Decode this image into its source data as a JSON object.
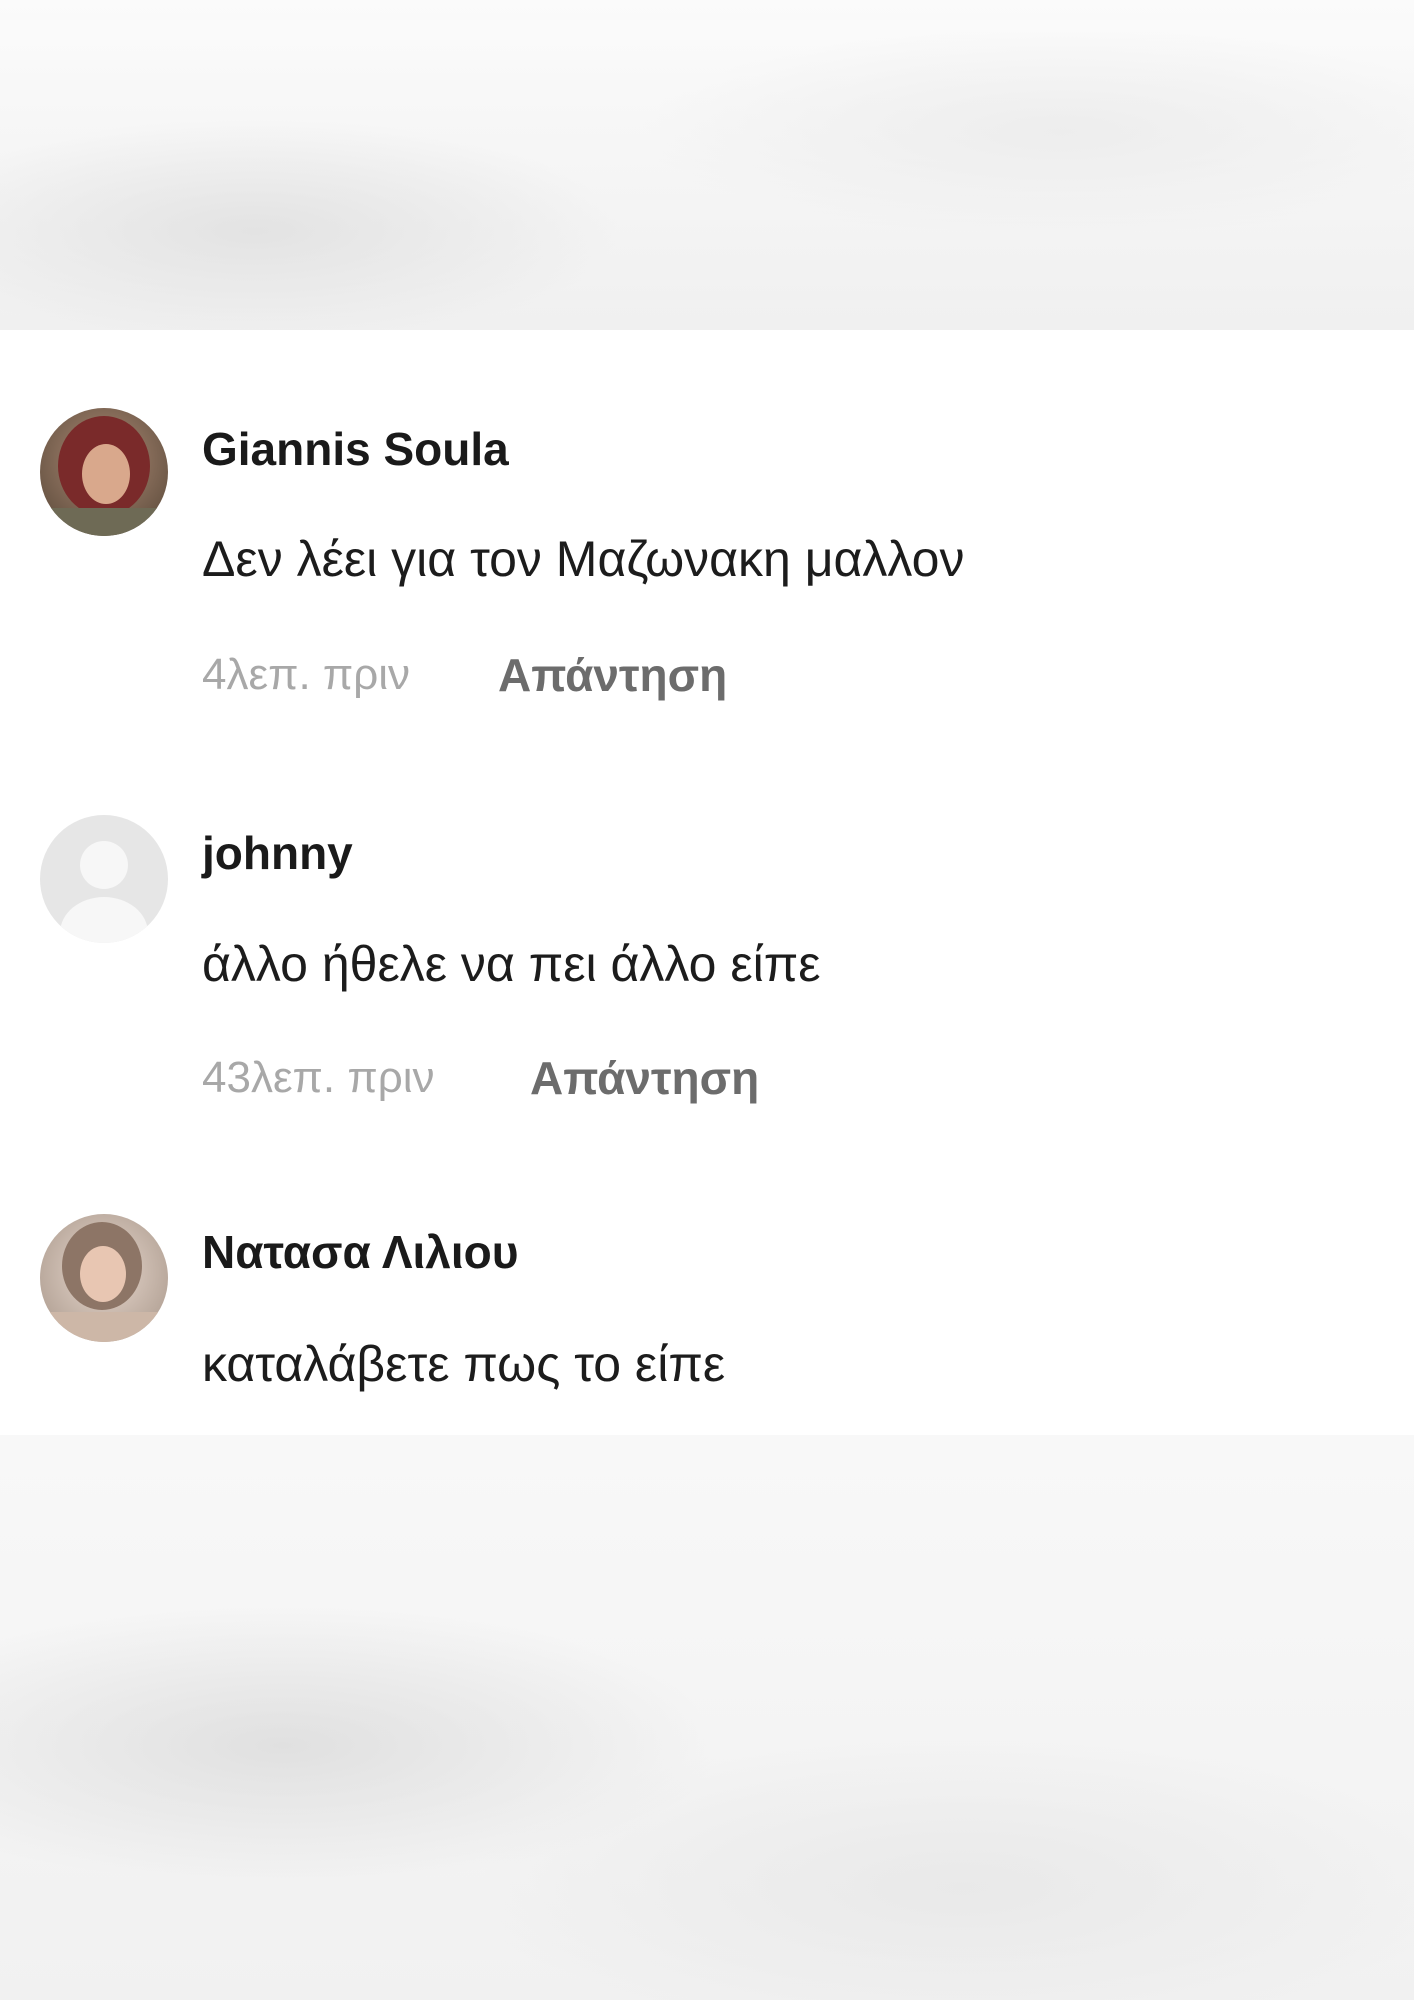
{
  "comments": [
    {
      "author": "Giannis Soula",
      "text": "Δεν λέει για τον Μαζωνακη μαλλον",
      "time": "4λεπ. πριν",
      "reply_label": "Απάντηση",
      "avatar": "user-photo-avatar"
    },
    {
      "author": "johnny",
      "text": "άλλο ήθελε να πει άλλο είπε",
      "time": "43λεπ. πριν",
      "reply_label": "Απάντηση",
      "avatar": "default-user-icon"
    },
    {
      "author": "Νατασα Λιλιου",
      "text": "καταλάβετε πως το είπε",
      "avatar": "user-photo-avatar"
    }
  ],
  "colors": {
    "author": "#1a1a1a",
    "comment_text": "#1c1c1c",
    "timestamp": "#a8a8a8",
    "reply": "#6c6c6c",
    "background": "#ffffff"
  }
}
